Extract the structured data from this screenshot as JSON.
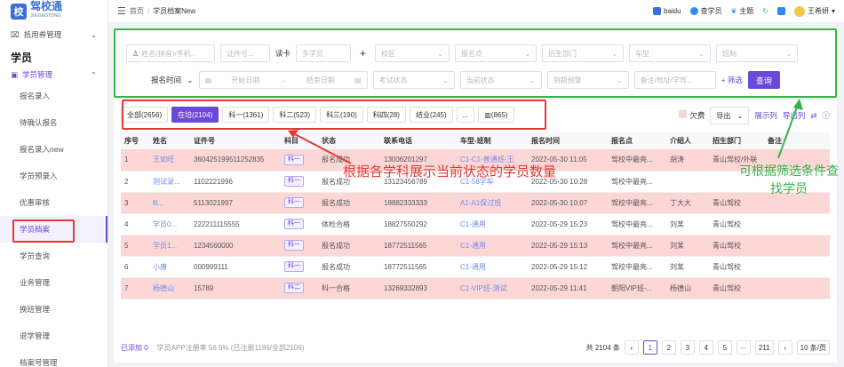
{
  "logo": {
    "mark": "校",
    "name": "驾校通",
    "sub": "JIAXIAOTONG"
  },
  "sidebar": {
    "group1": "抵用券管理",
    "section": "学员",
    "sub": "学员管理",
    "items": [
      "报名录入",
      "待确认报名",
      "报名录入new",
      "学员预录入",
      "优惠审核",
      "学员档案",
      "学员查询",
      "业务管理",
      "换班管理",
      "退学管理",
      "档案号管理"
    ]
  },
  "breadcrumb": {
    "home": "首页",
    "current": "学员档案New"
  },
  "topbar": {
    "baidu": "baidu",
    "viewer": "查学员",
    "theme": "主题",
    "user": "王希妍"
  },
  "filter": {
    "row1": {
      "name_ph": "姓名(拼音)/手机...",
      "idno_ph": "证件号...",
      "card": "读卡",
      "multi_ph": "多学员",
      "plus": "+",
      "campus": "校区",
      "point": "报名点",
      "dept": "招生部门",
      "cartype": "车型",
      "class": "班制"
    },
    "row2": {
      "signup_label": "报名时间",
      "start_ph": "开始日期",
      "arrow": "→",
      "end_ph": "结束日期",
      "exam": "考试状态",
      "current": "当前状态",
      "expire": "到期预警",
      "remark_ph": "备注/地址/学驾...",
      "more": "+ 筛选",
      "query": "查询"
    }
  },
  "tabs": [
    "全部(2656)",
    "在培(2104)",
    "科一(1361)",
    "科二(523)",
    "科三(190)",
    "科四(28)",
    "结业(245)",
    "...",
    "(865)"
  ],
  "tools": {
    "owe": "欠费",
    "export": "导出",
    "display": "展示列",
    "export_list": "导出列"
  },
  "table": {
    "headers": [
      "序号",
      "姓名",
      "证件号",
      "科目",
      "状态",
      "联系电话",
      "车型-班制",
      "报名时间",
      "报名点",
      "介绍人",
      "招生部门",
      "备注"
    ],
    "rows": [
      [
        "1",
        "王如旺",
        "360425199511252835",
        "科一",
        "报名成功",
        "13006201297",
        "C1-C1-普通班-王",
        "2022-05-30 11:05",
        "驾校中最亮...",
        "胡涛",
        "青山驾校/外联",
        ""
      ],
      [
        "2",
        "测试录...",
        "1102221996",
        "科一",
        "报名成功",
        "13123456789",
        "C1-58学车",
        "2022-05-30 10:28",
        "驾校中最亮...",
        "",
        "",
        ""
      ],
      [
        "3",
        "lll...",
        "5113021997",
        "科一",
        "报名成功",
        "18882333333",
        "A1-A1保过班",
        "2022-05-30 10:07",
        "驾校中最亮...",
        "丁大大",
        "青山驾校",
        ""
      ],
      [
        "4",
        "学员0...",
        "222211115555",
        "科一",
        "体检合格",
        "18827550292",
        "C1-通用",
        "2022-05-29 15:23",
        "驾校中最亮...",
        "刘某",
        "青山驾校",
        ""
      ],
      [
        "5",
        "学员1...",
        "1234560000",
        "科一",
        "报名成功",
        "18772511565",
        "C1-通用",
        "2022-05-29 15:13",
        "驾校中最亮...",
        "刘某",
        "青山驾校",
        ""
      ],
      [
        "6",
        "小唐",
        "000999111",
        "科一",
        "报名成功",
        "18772511565",
        "C1-通用",
        "2022-05-29 15:12",
        "驾校中最亮...",
        "刘某",
        "青山驾校",
        ""
      ],
      [
        "7",
        "杨德山",
        "15789",
        "科二",
        "科一合格",
        "13269332893",
        "C1-VIP班-测试",
        "2022-05-29 11:41",
        "朝阳VIP班-...",
        "杨德山",
        "青山驾校",
        ""
      ]
    ]
  },
  "footer": {
    "added": "已添加 0",
    "stat": "学员APP注册率 56.9% (已注册1199/全部2106)",
    "total": "共 2104 条",
    "pages": [
      "1",
      "2",
      "3",
      "4",
      "5",
      "···",
      "211"
    ],
    "per": "10 条/页"
  },
  "annotations": {
    "red": "根据各学科展示当前状态的学员数量",
    "green": "可根据筛选条件查找学员"
  },
  "colors": {
    "accent": "#6b48d8",
    "red": "#e53935",
    "green": "#36b34a",
    "pink": "#fdd6d6"
  }
}
